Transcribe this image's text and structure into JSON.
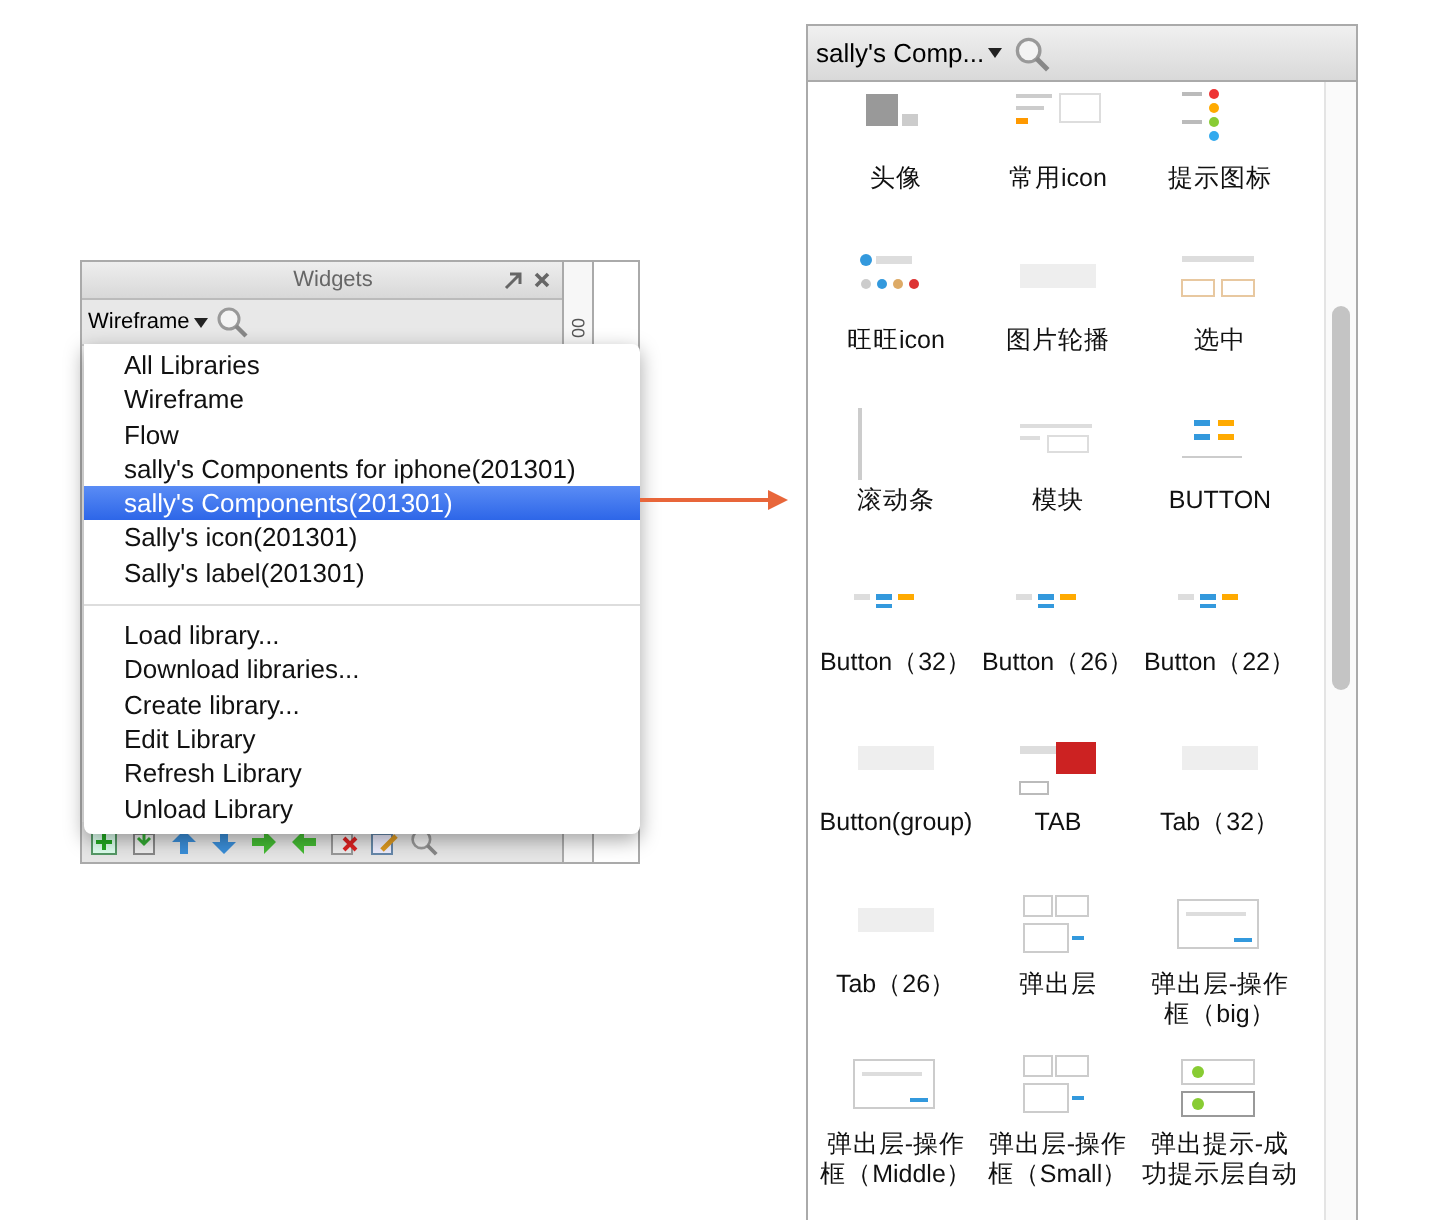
{
  "widgets_panel": {
    "title": "Widgets",
    "library_select": "Wireframe",
    "ruler_label": "00"
  },
  "library_menu": {
    "libraries": [
      {
        "label": "All Libraries",
        "selected": false
      },
      {
        "label": "Wireframe",
        "selected": false
      },
      {
        "label": "Flow",
        "selected": false
      },
      {
        "label": "sally's Components for iphone(201301)",
        "selected": false
      },
      {
        "label": "sally's Components(201301)",
        "selected": true
      },
      {
        "label": "Sally's icon(201301)",
        "selected": false
      },
      {
        "label": "Sally's label(201301)",
        "selected": false
      }
    ],
    "actions": [
      "Load library...",
      "Download libraries...",
      "Create library...",
      "Edit Library",
      "Refresh Library",
      "Unload Library"
    ]
  },
  "library_panel": {
    "library_select": "sally's Comp...",
    "widgets": [
      {
        "label": "头像"
      },
      {
        "label": "常用icon"
      },
      {
        "label": "提示图标"
      },
      {
        "label": "旺旺icon"
      },
      {
        "label": "图片轮播"
      },
      {
        "label": "选中"
      },
      {
        "label": "滚动条"
      },
      {
        "label": "模块"
      },
      {
        "label": "BUTTON"
      },
      {
        "label": "Button（32）"
      },
      {
        "label": "Button（26）"
      },
      {
        "label": "Button（22）"
      },
      {
        "label": "Button(group)"
      },
      {
        "label": "TAB"
      },
      {
        "label": "Tab（32）"
      },
      {
        "label": "Tab（26）"
      },
      {
        "label": "弹出层"
      },
      {
        "label": "弹出层-操作框（big）"
      },
      {
        "label": "弹出层-操作框（Middle）"
      },
      {
        "label": "弹出层-操作框（Small）"
      },
      {
        "label": "弹出提示-成功提示层自动"
      }
    ]
  }
}
